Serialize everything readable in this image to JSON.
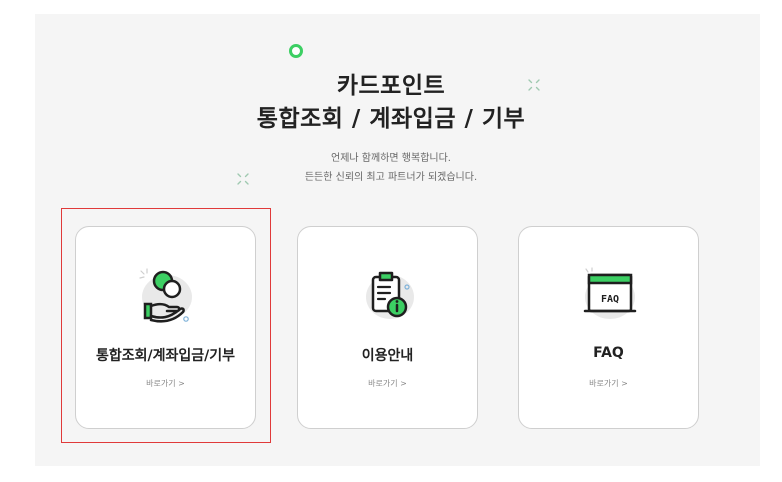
{
  "header": {
    "title_line1": "카드포인트",
    "title_line2": "통합조회 / 계좌입금 / 기부",
    "subtitle_line1": "언제나 함께하면 행복합니다.",
    "subtitle_line2": "든든한 신뢰의 최고 파트너가 되겠습니다."
  },
  "cards": [
    {
      "title": "통합조회/계좌입금/기부",
      "link": "바로가기 >",
      "icon": "coin-hand-icon",
      "selected": true
    },
    {
      "title": "이용안내",
      "link": "바로가기 >",
      "icon": "clipboard-info-icon",
      "selected": false
    },
    {
      "title": "FAQ",
      "link": "바로가기 >",
      "icon": "faq-window-icon",
      "selected": false
    }
  ],
  "colors": {
    "accent": "#3ccf63",
    "highlight_border": "#e03a3a",
    "icon_dark": "#1f1f1f",
    "icon_blob": "#e9e9e9"
  }
}
